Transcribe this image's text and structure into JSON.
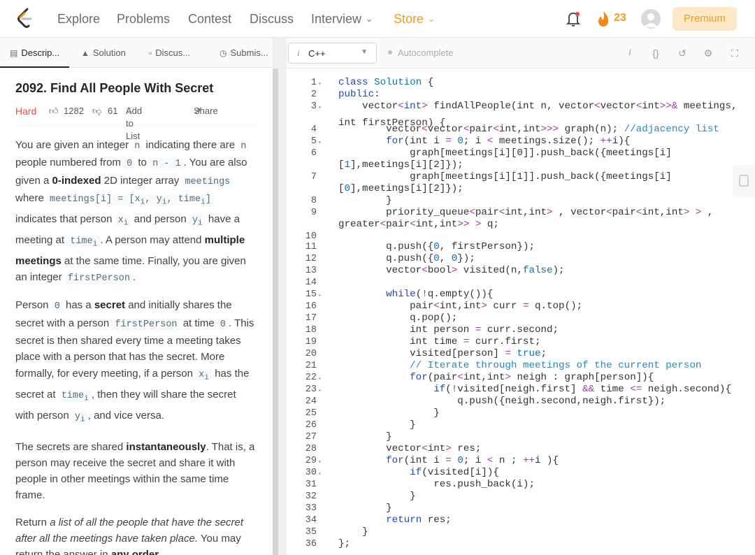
{
  "nav": {
    "items": [
      {
        "label": "Explore"
      },
      {
        "label": "Problems"
      },
      {
        "label": "Contest"
      },
      {
        "label": "Discuss"
      },
      {
        "label": "Interview"
      },
      {
        "label": "Store"
      }
    ],
    "streak_count": "23",
    "premium_label": "Premium",
    "colors": {
      "accent": "#f39c1a",
      "store": "#f39c1a"
    }
  },
  "tabs": [
    {
      "label": "Descrip...",
      "icon": "document-icon"
    },
    {
      "label": "Solution",
      "icon": "flask-icon"
    },
    {
      "label": "Discus...",
      "icon": "chat-icon"
    },
    {
      "label": "Submis...",
      "icon": "clock-icon"
    }
  ],
  "problem": {
    "title": "2092. Find All People With Secret",
    "difficulty": "Hard",
    "likes": "1282",
    "dislikes": "61",
    "add_to_list": "Add to List",
    "share": "Share",
    "difficulty_color": "#ef4743"
  },
  "description": {
    "p1": {
      "a": "You are given an integer ",
      "n": "n",
      "b": " indicating there are ",
      "n2": "n",
      "c": " people numbered from ",
      "zero": "0",
      "d": " to ",
      "nm1": "n - 1",
      "e": ". You are also given a ",
      "zero_indexed": "0-indexed",
      "f": " 2D integer array ",
      "meetings": "meetings",
      "g": " where ",
      "meetings_i": "meetings[i] = [x",
      "sub_i1": "i",
      "sep1": ", y",
      "sub_i2": "i",
      "sep2": ", time",
      "sub_i3": "i",
      "close": "]",
      "h": " indicates that person ",
      "x": "x",
      "xi": "i",
      "i1": " and person ",
      "y": "y",
      "yi": "i",
      "j": " have a meeting at ",
      "time": "time",
      "ti": "i",
      "k": ". A person may attend ",
      "multiple": "multiple meetings",
      "l": " at the same time. Finally, you are given an integer ",
      "firstPerson": "firstPerson",
      "m": "."
    },
    "p2": {
      "a": "Person ",
      "zero": "0",
      "b": " has a ",
      "secret": "secret",
      "c": " and initially shares the secret with a person ",
      "firstPerson": "firstPerson",
      "d": " at time ",
      "zero2": "0",
      "e": ". This secret is then shared every time a meeting takes place with a person that has the secret. More formally, for every meeting, if a person ",
      "x": "x",
      "xi": "i",
      "f": " has the secret at ",
      "time": "time",
      "ti": "i",
      "g": ", then they will share the secret with person ",
      "y": "y",
      "yi": "i",
      "h": ", and vice versa."
    },
    "p3": {
      "a": "The secrets are shared ",
      "instantly": "instantaneously",
      "b": ". That is, a person may receive the secret and share it with people in other meetings within the same time frame."
    },
    "p4": {
      "a": "Return ",
      "italic": "a list of all the people that have the secret after all the meetings have taken place.",
      "b": " You may return the answer in ",
      "any": "any order",
      "c": "."
    }
  },
  "editor": {
    "language": "C++",
    "autocomplete": "Autocomplete",
    "active_line": 34,
    "lines": [
      {
        "n": "1",
        "fold": true
      },
      {
        "n": "2"
      },
      {
        "n": "3",
        "fold": true
      },
      {
        "n": ""
      },
      {
        "n": "4"
      },
      {
        "n": "5",
        "fold": true
      },
      {
        "n": "6"
      },
      {
        "n": ""
      },
      {
        "n": "7"
      },
      {
        "n": ""
      },
      {
        "n": "8"
      },
      {
        "n": "9"
      },
      {
        "n": ""
      },
      {
        "n": "10"
      },
      {
        "n": "11"
      },
      {
        "n": "12"
      },
      {
        "n": "13"
      },
      {
        "n": "14"
      },
      {
        "n": "15",
        "fold": true
      },
      {
        "n": "16"
      },
      {
        "n": "17"
      },
      {
        "n": "18"
      },
      {
        "n": "19"
      },
      {
        "n": "20"
      },
      {
        "n": "21"
      },
      {
        "n": "22",
        "fold": true
      },
      {
        "n": "23",
        "fold": true
      },
      {
        "n": "24"
      },
      {
        "n": "25"
      },
      {
        "n": "26"
      },
      {
        "n": "27"
      },
      {
        "n": "28"
      },
      {
        "n": "29",
        "fold": true
      },
      {
        "n": "30",
        "fold": true
      },
      {
        "n": "31"
      },
      {
        "n": "32"
      },
      {
        "n": "33"
      },
      {
        "n": "34"
      },
      {
        "n": "35"
      },
      {
        "n": "36"
      }
    ],
    "code": [
      [
        [
          "k",
          "class"
        ],
        [
          "t",
          " "
        ],
        [
          "n",
          "Solution"
        ],
        [
          "t",
          " {"
        ]
      ],
      [
        [
          "k",
          "public"
        ],
        [
          "t",
          ":"
        ]
      ],
      [
        [
          "t",
          "    vector"
        ],
        [
          "o",
          "<"
        ],
        [
          "k",
          "int"
        ],
        [
          "o",
          ">"
        ],
        [
          "t",
          " findAllPeople(int n, vector"
        ],
        [
          "o",
          "<"
        ],
        [
          "t",
          "vector"
        ],
        [
          "o",
          "<"
        ],
        [
          "t",
          "int"
        ],
        [
          "o",
          ">>&"
        ],
        [
          "t",
          " meetings,"
        ]
      ],
      [
        [
          "t",
          "int firstPerson) {"
        ]
      ],
      [
        [
          "t",
          "        vector"
        ],
        [
          "o",
          "<"
        ],
        [
          "t",
          "vector"
        ],
        [
          "o",
          "<"
        ],
        [
          "t",
          "pair"
        ],
        [
          "o",
          "<"
        ],
        [
          "t",
          "int,int"
        ],
        [
          "o",
          ">>>"
        ],
        [
          "t",
          " graph(n); "
        ],
        [
          "cm",
          "//adjacency list"
        ]
      ],
      [
        [
          "t",
          "        "
        ],
        [
          "k",
          "for"
        ],
        [
          "t",
          "(int i "
        ],
        [
          "o",
          "="
        ],
        [
          "t",
          " "
        ],
        [
          "n",
          "0"
        ],
        [
          "t",
          "; i "
        ],
        [
          "o",
          "<"
        ],
        [
          "t",
          " meetings.size(); "
        ],
        [
          "o",
          "++"
        ],
        [
          "t",
          "i){"
        ]
      ],
      [
        [
          "t",
          "            graph[meetings[i][0]].push_back({meetings[i]"
        ]
      ],
      [
        [
          "t",
          "["
        ],
        [
          "n",
          "1"
        ],
        [
          "t",
          "],meetings[i][2]});"
        ]
      ],
      [
        [
          "t",
          "            graph[meetings[i][1]].push_back({meetings[i]"
        ]
      ],
      [
        [
          "t",
          "["
        ],
        [
          "n",
          "0"
        ],
        [
          "t",
          "],meetings[i][2]});"
        ]
      ],
      [
        [
          "t",
          "        }"
        ]
      ],
      [
        [
          "t",
          "        priority_queue"
        ],
        [
          "o",
          "<"
        ],
        [
          "t",
          "pair"
        ],
        [
          "o",
          "<"
        ],
        [
          "t",
          "int,int"
        ],
        [
          "o",
          ">"
        ],
        [
          "t",
          " , vector"
        ],
        [
          "o",
          "<"
        ],
        [
          "t",
          "pair"
        ],
        [
          "o",
          "<"
        ],
        [
          "t",
          "int,int"
        ],
        [
          "o",
          "> >"
        ],
        [
          "t",
          " ,"
        ]
      ],
      [
        [
          "t",
          "greater"
        ],
        [
          "o",
          "<"
        ],
        [
          "t",
          "pair"
        ],
        [
          "o",
          "<"
        ],
        [
          "t",
          "int,int"
        ],
        [
          "o",
          ">> >"
        ],
        [
          "t",
          " q;"
        ]
      ],
      [
        [
          "t",
          ""
        ]
      ],
      [
        [
          "t",
          "        q.push({"
        ],
        [
          "n",
          "0"
        ],
        [
          "t",
          ", firstPerson});"
        ]
      ],
      [
        [
          "t",
          "        q.push({"
        ],
        [
          "n",
          "0"
        ],
        [
          "t",
          ", "
        ],
        [
          "n",
          "0"
        ],
        [
          "t",
          "});"
        ]
      ],
      [
        [
          "t",
          "        vector"
        ],
        [
          "o",
          "<"
        ],
        [
          "t",
          "bool"
        ],
        [
          "o",
          ">"
        ],
        [
          "t",
          " visited(n,"
        ],
        [
          "n",
          "false"
        ],
        [
          "t",
          ");"
        ]
      ],
      [
        [
          "t",
          ""
        ]
      ],
      [
        [
          "t",
          "        "
        ],
        [
          "k",
          "while"
        ],
        [
          "t",
          "("
        ],
        [
          "o",
          "!"
        ],
        [
          "t",
          "q.empty()){"
        ]
      ],
      [
        [
          "t",
          "            pair"
        ],
        [
          "o",
          "<"
        ],
        [
          "t",
          "int,int"
        ],
        [
          "o",
          ">"
        ],
        [
          "t",
          " curr "
        ],
        [
          "o",
          "="
        ],
        [
          "t",
          " q.top();"
        ]
      ],
      [
        [
          "t",
          "            q.pop();"
        ]
      ],
      [
        [
          "t",
          "            int person "
        ],
        [
          "o",
          "="
        ],
        [
          "t",
          " curr.second;"
        ]
      ],
      [
        [
          "t",
          "            int time "
        ],
        [
          "o",
          "="
        ],
        [
          "t",
          " curr.first;"
        ]
      ],
      [
        [
          "t",
          "            visited[person] "
        ],
        [
          "o",
          "="
        ],
        [
          "t",
          " "
        ],
        [
          "n",
          "true"
        ],
        [
          "t",
          ";"
        ]
      ],
      [
        [
          "cm",
          "            // Iterate through meetings of the current person"
        ]
      ],
      [
        [
          "t",
          "            "
        ],
        [
          "k",
          "for"
        ],
        [
          "t",
          "(pair"
        ],
        [
          "o",
          "<"
        ],
        [
          "t",
          "int,int"
        ],
        [
          "o",
          ">"
        ],
        [
          "t",
          " neigh : graph[person]){"
        ]
      ],
      [
        [
          "t",
          "                "
        ],
        [
          "k",
          "if"
        ],
        [
          "t",
          "("
        ],
        [
          "o",
          "!"
        ],
        [
          "t",
          "visited[neigh.first] "
        ],
        [
          "o",
          "&&"
        ],
        [
          "t",
          " time "
        ],
        [
          "o",
          "<="
        ],
        [
          "t",
          " neigh.second){"
        ]
      ],
      [
        [
          "t",
          "                    q.push({neigh.second,neigh.first});"
        ]
      ],
      [
        [
          "t",
          "                }"
        ]
      ],
      [
        [
          "t",
          "            }"
        ]
      ],
      [
        [
          "t",
          "        }"
        ]
      ],
      [
        [
          "t",
          "        vector"
        ],
        [
          "o",
          "<"
        ],
        [
          "t",
          "int"
        ],
        [
          "o",
          ">"
        ],
        [
          "t",
          " res;"
        ]
      ],
      [
        [
          "t",
          "        "
        ],
        [
          "k",
          "for"
        ],
        [
          "t",
          "(int i "
        ],
        [
          "o",
          "="
        ],
        [
          "t",
          " "
        ],
        [
          "n",
          "0"
        ],
        [
          "t",
          "; i "
        ],
        [
          "o",
          "<"
        ],
        [
          "t",
          " n ; "
        ],
        [
          "o",
          "++"
        ],
        [
          "t",
          "i ){"
        ]
      ],
      [
        [
          "t",
          "            "
        ],
        [
          "k",
          "if"
        ],
        [
          "t",
          "(visited[i]){"
        ]
      ],
      [
        [
          "t",
          "                res.push_back(i);"
        ]
      ],
      [
        [
          "t",
          "            }"
        ]
      ],
      [
        [
          "t",
          "        }"
        ]
      ],
      [
        [
          "t",
          "        "
        ],
        [
          "k",
          "return"
        ],
        [
          "t",
          " res;"
        ]
      ],
      [
        [
          "t",
          "    }"
        ]
      ],
      [
        [
          "t",
          "};"
        ]
      ]
    ]
  }
}
